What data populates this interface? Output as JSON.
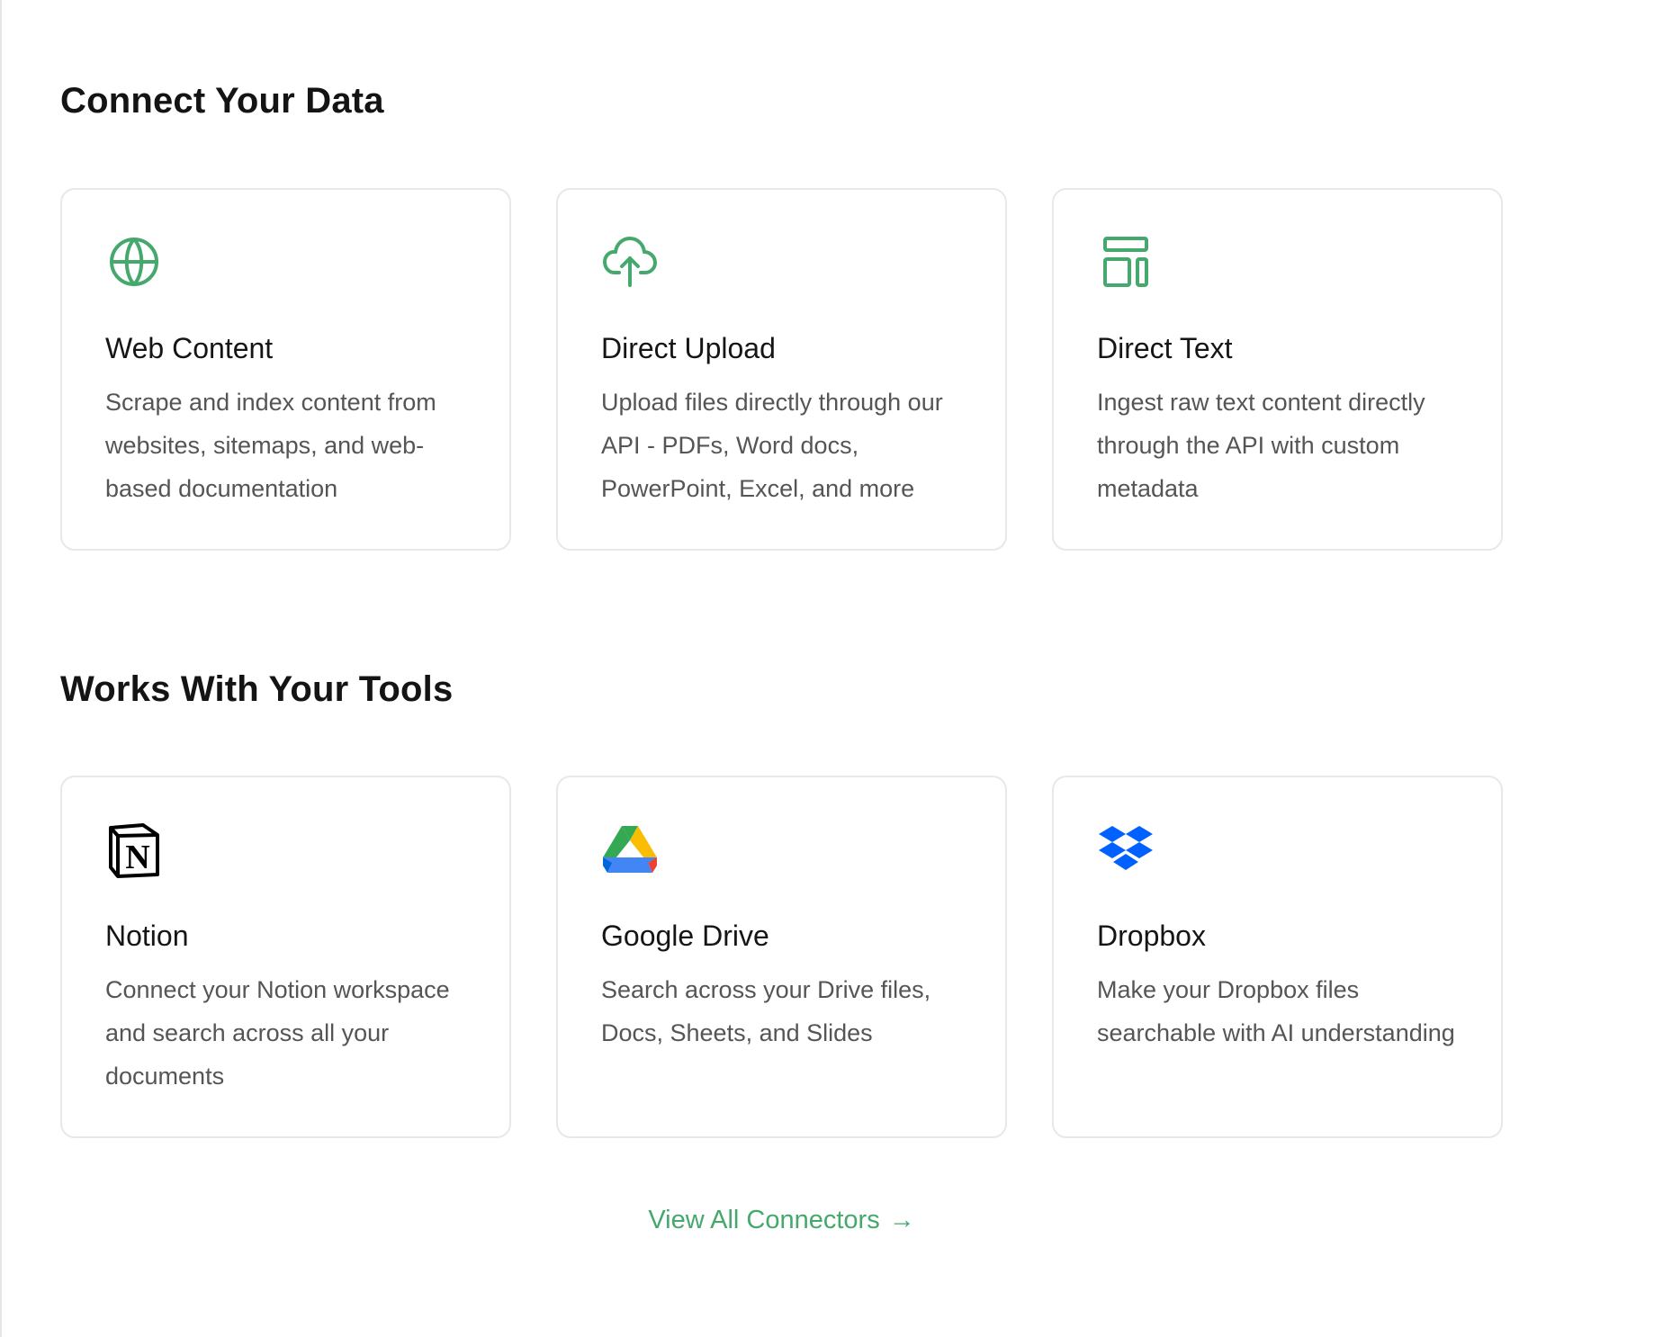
{
  "colors": {
    "accent": "#45a86c",
    "card_border": "#e8e8e8",
    "heading": "#141414",
    "description": "#555555",
    "dropbox_blue": "#0061fe"
  },
  "sections": {
    "connect": {
      "title": "Connect Your Data",
      "cards": [
        {
          "icon": "globe-icon",
          "title": "Web Content",
          "description": "Scrape and index content from websites, sitemaps, and web-based documentation"
        },
        {
          "icon": "cloud-upload-icon",
          "title": "Direct Upload",
          "description": "Upload files directly through our API - PDFs, Word docs, PowerPoint, Excel, and more"
        },
        {
          "icon": "layout-panels-icon",
          "title": "Direct Text",
          "description": "Ingest raw text content directly through the API with custom metadata"
        }
      ]
    },
    "tools": {
      "title": "Works With Your Tools",
      "cards": [
        {
          "icon": "notion-logo-icon",
          "title": "Notion",
          "description": "Connect your Notion workspace and search across all your documents"
        },
        {
          "icon": "google-drive-logo-icon",
          "title": "Google Drive",
          "description": "Search across your Drive files, Docs, Sheets, and Slides"
        },
        {
          "icon": "dropbox-logo-icon",
          "title": "Dropbox",
          "description": "Make your Dropbox files searchable with AI understanding"
        }
      ]
    }
  },
  "view_all": {
    "label": "View All Connectors",
    "arrow": "→"
  }
}
